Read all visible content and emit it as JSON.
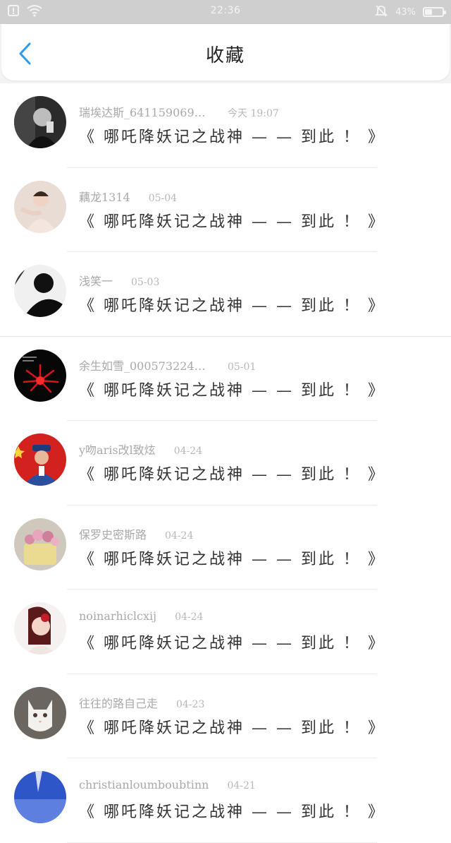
{
  "status_bar": {
    "time": "22:36",
    "battery_text": "43%",
    "battery_level": 0.43
  },
  "header": {
    "title": "收藏",
    "back_icon": "chevron-left-icon",
    "accent_color": "#2a9bf0"
  },
  "items": [
    {
      "user": "瑞埃达斯_6411590698 ...",
      "date": "今天 19:07",
      "title": "《 哪吒降妖记之战神 — — 到此 ！ 》",
      "avatar": "dark-portrait"
    },
    {
      "user": "藕龙1314",
      "date": "05-04",
      "title": "《 哪吒降妖记之战神 — — 到此 ！ 》",
      "avatar": "girl-costume"
    },
    {
      "user": "浅笑一",
      "date": "05-03",
      "title": "《 哪吒降妖记之战神 — — 到此 ！ 》",
      "avatar": "silhouette-bw"
    },
    {
      "user": "余生如雪_0005732247 ...",
      "date": "05-01",
      "title": "《 哪吒降妖记之战神 — — 到此 ！ 》",
      "avatar": "red-flower"
    },
    {
      "user": "y吻aris改l致炫",
      "date": "04-24",
      "title": "《 哪吒降妖记之战神 — — 到此 ！ 》",
      "avatar": "soldier-flag"
    },
    {
      "user": "保罗史密斯路",
      "date": "04-24",
      "title": "《 哪吒降妖记之战神 — — 到此 ！ 》",
      "avatar": "flower-basket"
    },
    {
      "user": "noinarhiclcxij",
      "date": "04-24",
      "title": "《 哪吒降妖记之战神 — — 到此 ！ 》",
      "avatar": "woman-portrait"
    },
    {
      "user": "往往的路自己走",
      "date": "04-23",
      "title": "《 哪吒降妖记之战神 — — 到此 ！ 》",
      "avatar": "white-cat"
    },
    {
      "user": "christianloumboubtinn",
      "date": "04-21",
      "title": "《 哪吒降妖记之战神 — — 到此 ！ 》",
      "avatar": "blue-sky"
    }
  ]
}
